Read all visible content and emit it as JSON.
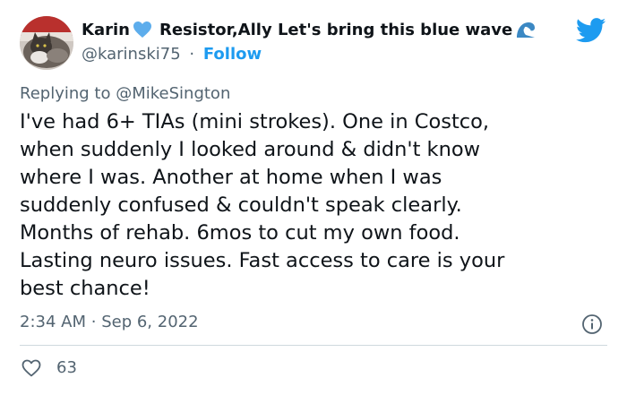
{
  "author": {
    "name": "Karin",
    "name_suffix": "Resistor,Ally Let's bring this blue wave",
    "handle": "@karinski75",
    "separator": "·",
    "follow_label": "Follow",
    "icons": [
      "blue-heart-emoji",
      "water-wave-emoji"
    ]
  },
  "brand": {
    "icon": "twitter-bird-icon",
    "color": "#1d9bf0"
  },
  "reply": {
    "prefix": "Replying to",
    "mention": "@MikeSington"
  },
  "tweet": {
    "lines": [
      "I've had 6+ TIAs (mini strokes). One in Costco,",
      "when suddenly I looked around & didn't know",
      "where I was. Another at home when I was",
      "suddenly confused & couldn't speak clearly.",
      "Months of rehab. 6mos to cut my own food.",
      "Lasting neuro issues. Fast access to care is your",
      "best chance!"
    ]
  },
  "meta": {
    "time": "2:34 AM",
    "separator": "·",
    "date": "Sep 6, 2022",
    "info_icon": "info-icon"
  },
  "engagement": {
    "like_icon": "heart-outline-icon",
    "likes": "63"
  },
  "colors": {
    "text": "#0f1419",
    "secondary": "#536471",
    "accent": "#1d9bf0",
    "divider": "#cfd9de"
  }
}
